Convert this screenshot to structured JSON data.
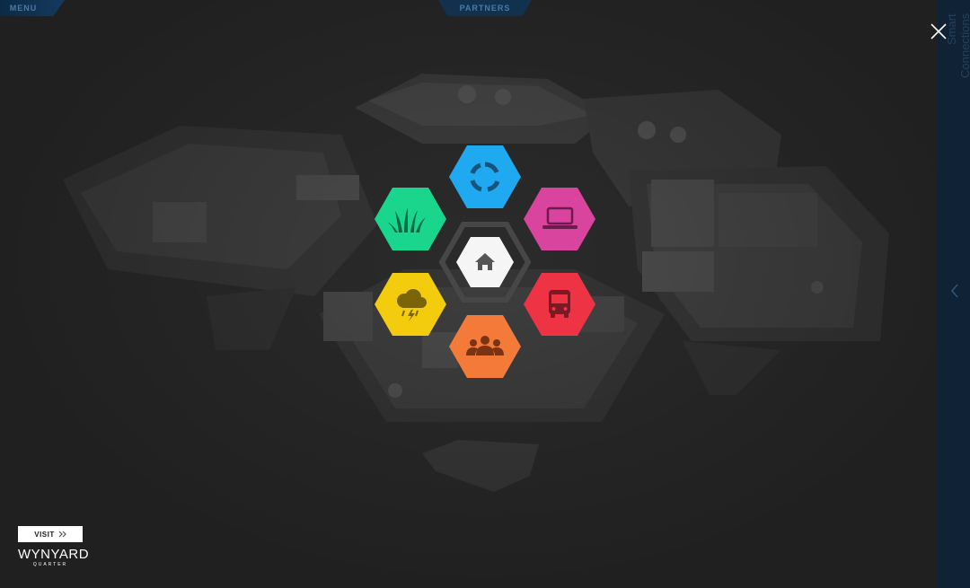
{
  "nav": {
    "menu_label": "MENU",
    "partners_label": "PARTNERS"
  },
  "side_panel": {
    "label": "Smart Connections"
  },
  "hex_menu": {
    "center": {
      "icon": "home-icon",
      "color": "#f5f5f5"
    },
    "items": [
      {
        "icon": "loop-icon",
        "color": "#1fa9f0"
      },
      {
        "icon": "laptop-icon",
        "color": "#d9449e"
      },
      {
        "icon": "bus-icon",
        "color": "#ee3345"
      },
      {
        "icon": "people-icon",
        "color": "#f47a3a"
      },
      {
        "icon": "weather-icon",
        "color": "#f2cc0d"
      },
      {
        "icon": "grass-icon",
        "color": "#19d68c"
      }
    ]
  },
  "brand": {
    "visit_label": "VISIT",
    "logo_text": "WYNYARD",
    "logo_sub": "QUARTER"
  }
}
